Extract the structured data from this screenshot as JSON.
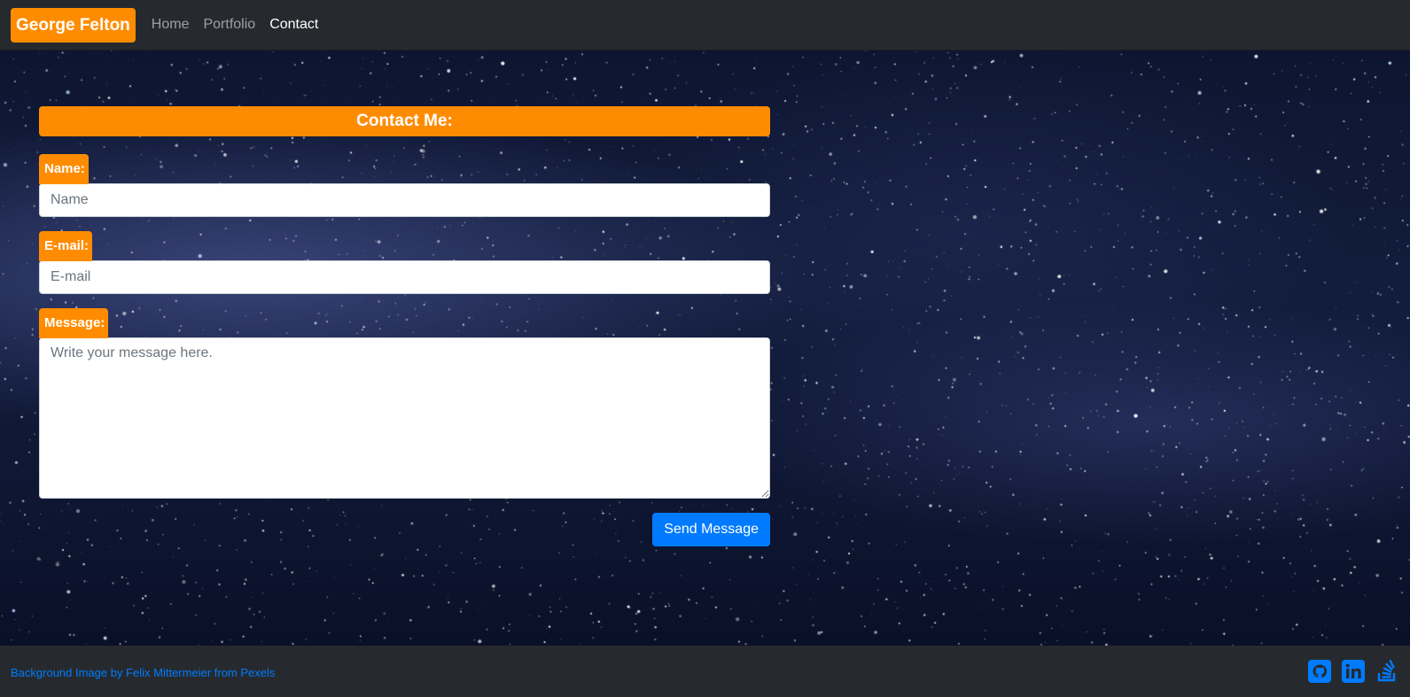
{
  "navbar": {
    "brand": "George Felton",
    "links": [
      {
        "label": "Home",
        "active": false
      },
      {
        "label": "Portfolio",
        "active": false
      },
      {
        "label": "Contact",
        "active": true
      }
    ]
  },
  "contact": {
    "header": "Contact Me:",
    "name_label": "Name:",
    "name_placeholder": "Name",
    "email_label": "E-mail:",
    "email_placeholder": "E-mail",
    "message_label": "Message:",
    "message_placeholder": "Write your message here.",
    "send_label": "Send Message"
  },
  "footer": {
    "credit": "Background Image by Felix Mittermeier from Pexels",
    "socials": [
      {
        "icon": "github-icon"
      },
      {
        "icon": "linkedin-icon"
      },
      {
        "icon": "stackoverflow-icon"
      }
    ]
  },
  "colors": {
    "accent": "#ff8c00",
    "primary": "#007bff",
    "navbar_bg": "#262a2e"
  }
}
